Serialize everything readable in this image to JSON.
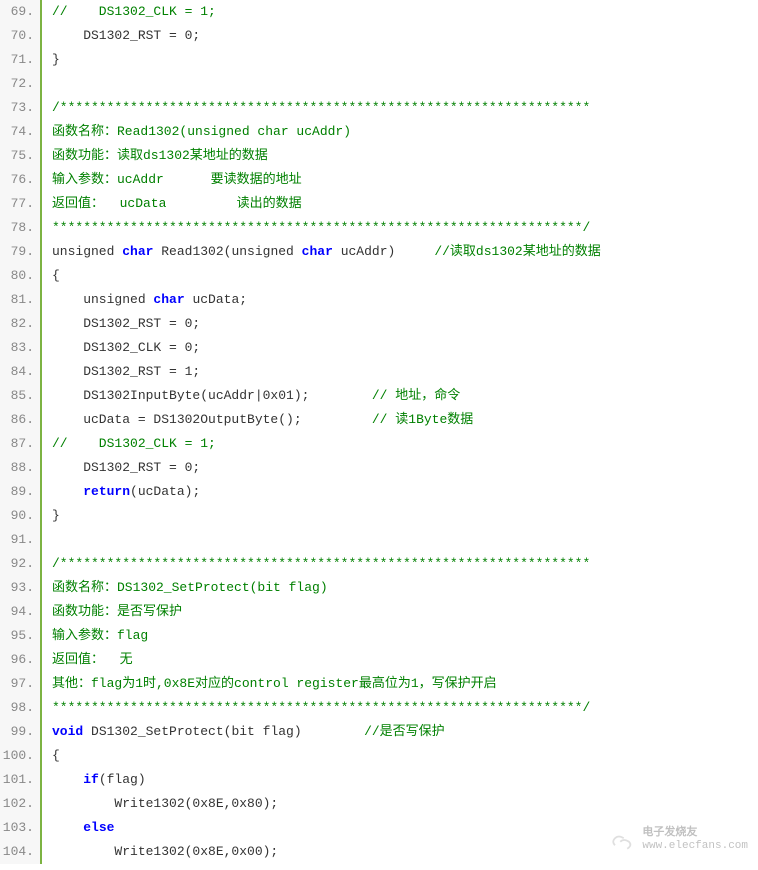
{
  "lines": [
    {
      "num": "69.",
      "content": [
        {
          "t": "comment",
          "v": "//    DS1302_CLK = 1;"
        }
      ]
    },
    {
      "num": "70.",
      "content": [
        {
          "t": "plain",
          "v": "    DS1302_RST = 0;"
        }
      ]
    },
    {
      "num": "71.",
      "content": [
        {
          "t": "plain",
          "v": "}"
        }
      ]
    },
    {
      "num": "72.",
      "content": [
        {
          "t": "plain",
          "v": " "
        }
      ]
    },
    {
      "num": "73.",
      "content": [
        {
          "t": "comment",
          "v": "/********************************************************************"
        }
      ]
    },
    {
      "num": "74.",
      "content": [
        {
          "t": "comment",
          "v": "函数名称：Read1302(unsigned char ucAddr)"
        }
      ]
    },
    {
      "num": "75.",
      "content": [
        {
          "t": "comment",
          "v": "函数功能：读取ds1302某地址的数据"
        }
      ]
    },
    {
      "num": "76.",
      "content": [
        {
          "t": "comment",
          "v": "输入参数：ucAddr      要读数据的地址"
        }
      ]
    },
    {
      "num": "77.",
      "content": [
        {
          "t": "comment",
          "v": "返回值：  ucData         读出的数据"
        }
      ]
    },
    {
      "num": "78.",
      "content": [
        {
          "t": "comment",
          "v": "********************************************************************/"
        }
      ]
    },
    {
      "num": "79.",
      "content": [
        {
          "t": "plain",
          "v": "unsigned "
        },
        {
          "t": "keyword",
          "v": "char"
        },
        {
          "t": "plain",
          "v": " Read1302(unsigned "
        },
        {
          "t": "keyword",
          "v": "char"
        },
        {
          "t": "plain",
          "v": " ucAddr)     "
        },
        {
          "t": "comment",
          "v": "//读取ds1302某地址的数据"
        }
      ]
    },
    {
      "num": "80.",
      "content": [
        {
          "t": "plain",
          "v": "{"
        }
      ]
    },
    {
      "num": "81.",
      "content": [
        {
          "t": "plain",
          "v": "    unsigned "
        },
        {
          "t": "keyword",
          "v": "char"
        },
        {
          "t": "plain",
          "v": " ucData;"
        }
      ]
    },
    {
      "num": "82.",
      "content": [
        {
          "t": "plain",
          "v": "    DS1302_RST = 0;"
        }
      ]
    },
    {
      "num": "83.",
      "content": [
        {
          "t": "plain",
          "v": "    DS1302_CLK = 0;"
        }
      ]
    },
    {
      "num": "84.",
      "content": [
        {
          "t": "plain",
          "v": "    DS1302_RST = 1;"
        }
      ]
    },
    {
      "num": "85.",
      "content": [
        {
          "t": "plain",
          "v": "    DS1302InputByte(ucAddr|0x01);        "
        },
        {
          "t": "comment",
          "v": "// 地址，命令"
        }
      ]
    },
    {
      "num": "86.",
      "content": [
        {
          "t": "plain",
          "v": "    ucData = DS1302OutputByte();         "
        },
        {
          "t": "comment",
          "v": "// 读1Byte数据"
        }
      ]
    },
    {
      "num": "87.",
      "content": [
        {
          "t": "comment",
          "v": "//    DS1302_CLK = 1;"
        }
      ]
    },
    {
      "num": "88.",
      "content": [
        {
          "t": "plain",
          "v": "    DS1302_RST = 0;"
        }
      ]
    },
    {
      "num": "89.",
      "content": [
        {
          "t": "plain",
          "v": "    "
        },
        {
          "t": "keyword",
          "v": "return"
        },
        {
          "t": "plain",
          "v": "(ucData);"
        }
      ]
    },
    {
      "num": "90.",
      "content": [
        {
          "t": "plain",
          "v": "}"
        }
      ]
    },
    {
      "num": "91.",
      "content": [
        {
          "t": "plain",
          "v": " "
        }
      ]
    },
    {
      "num": "92.",
      "content": [
        {
          "t": "comment",
          "v": "/********************************************************************"
        }
      ]
    },
    {
      "num": "93.",
      "content": [
        {
          "t": "comment",
          "v": "函数名称：DS1302_SetProtect(bit flag)"
        }
      ]
    },
    {
      "num": "94.",
      "content": [
        {
          "t": "comment",
          "v": "函数功能：是否写保护"
        }
      ]
    },
    {
      "num": "95.",
      "content": [
        {
          "t": "comment",
          "v": "输入参数：flag"
        }
      ]
    },
    {
      "num": "96.",
      "content": [
        {
          "t": "comment",
          "v": "返回值：  无"
        }
      ]
    },
    {
      "num": "97.",
      "content": [
        {
          "t": "comment",
          "v": "其他：flag为1时,0x8E对应的control register最高位为1，写保护开启"
        }
      ]
    },
    {
      "num": "98.",
      "content": [
        {
          "t": "comment",
          "v": "********************************************************************/"
        }
      ]
    },
    {
      "num": "99.",
      "content": [
        {
          "t": "keyword",
          "v": "void"
        },
        {
          "t": "plain",
          "v": " DS1302_SetProtect(bit flag)        "
        },
        {
          "t": "comment",
          "v": "//是否写保护"
        }
      ]
    },
    {
      "num": "100.",
      "content": [
        {
          "t": "plain",
          "v": "{"
        }
      ]
    },
    {
      "num": "101.",
      "content": [
        {
          "t": "plain",
          "v": "    "
        },
        {
          "t": "keyword",
          "v": "if"
        },
        {
          "t": "plain",
          "v": "(flag)"
        }
      ]
    },
    {
      "num": "102.",
      "content": [
        {
          "t": "plain",
          "v": "        Write1302(0x8E,0x80);"
        }
      ]
    },
    {
      "num": "103.",
      "content": [
        {
          "t": "plain",
          "v": "    "
        },
        {
          "t": "keyword",
          "v": "else"
        }
      ]
    },
    {
      "num": "104.",
      "content": [
        {
          "t": "plain",
          "v": "        Write1302(0x8E,0x00);"
        }
      ]
    }
  ],
  "watermark": {
    "cn": "电子发烧友",
    "url": "www.elecfans.com"
  }
}
